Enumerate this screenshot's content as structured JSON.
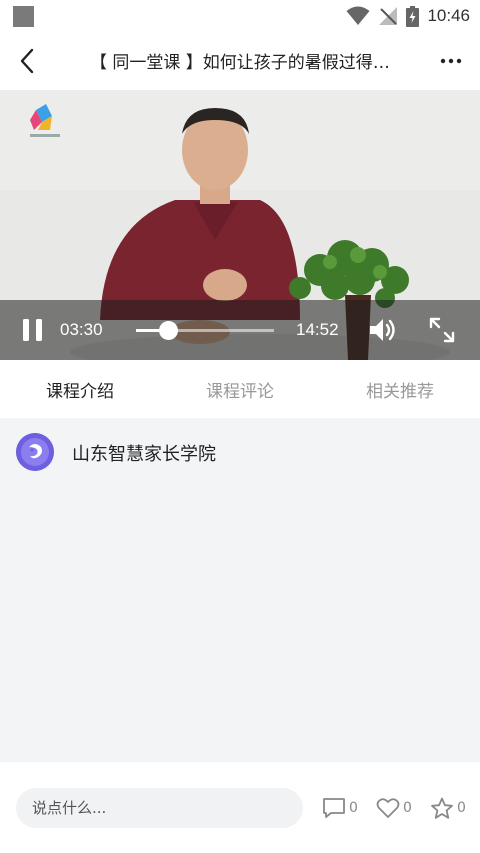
{
  "status_bar": {
    "time": "10:46"
  },
  "app_bar": {
    "title": "【 同一堂课 】如何让孩子的暑假过得更有意义"
  },
  "video": {
    "current_time": "03:30",
    "total_time": "14:52",
    "progress": 0.235
  },
  "tabs": [
    {
      "label": "课程介绍",
      "active": true
    },
    {
      "label": "课程评论",
      "active": false
    },
    {
      "label": "相关推荐",
      "active": false
    }
  ],
  "course_info": {
    "publisher_name": "山东智慧家长学院"
  },
  "bottom_bar": {
    "comment_placeholder": "说点什么...",
    "comment_count": "0",
    "like_count": "0",
    "favorite_count": "0"
  },
  "colors": {
    "accent": "#6d5fe0",
    "background": "#f3f4f6"
  }
}
